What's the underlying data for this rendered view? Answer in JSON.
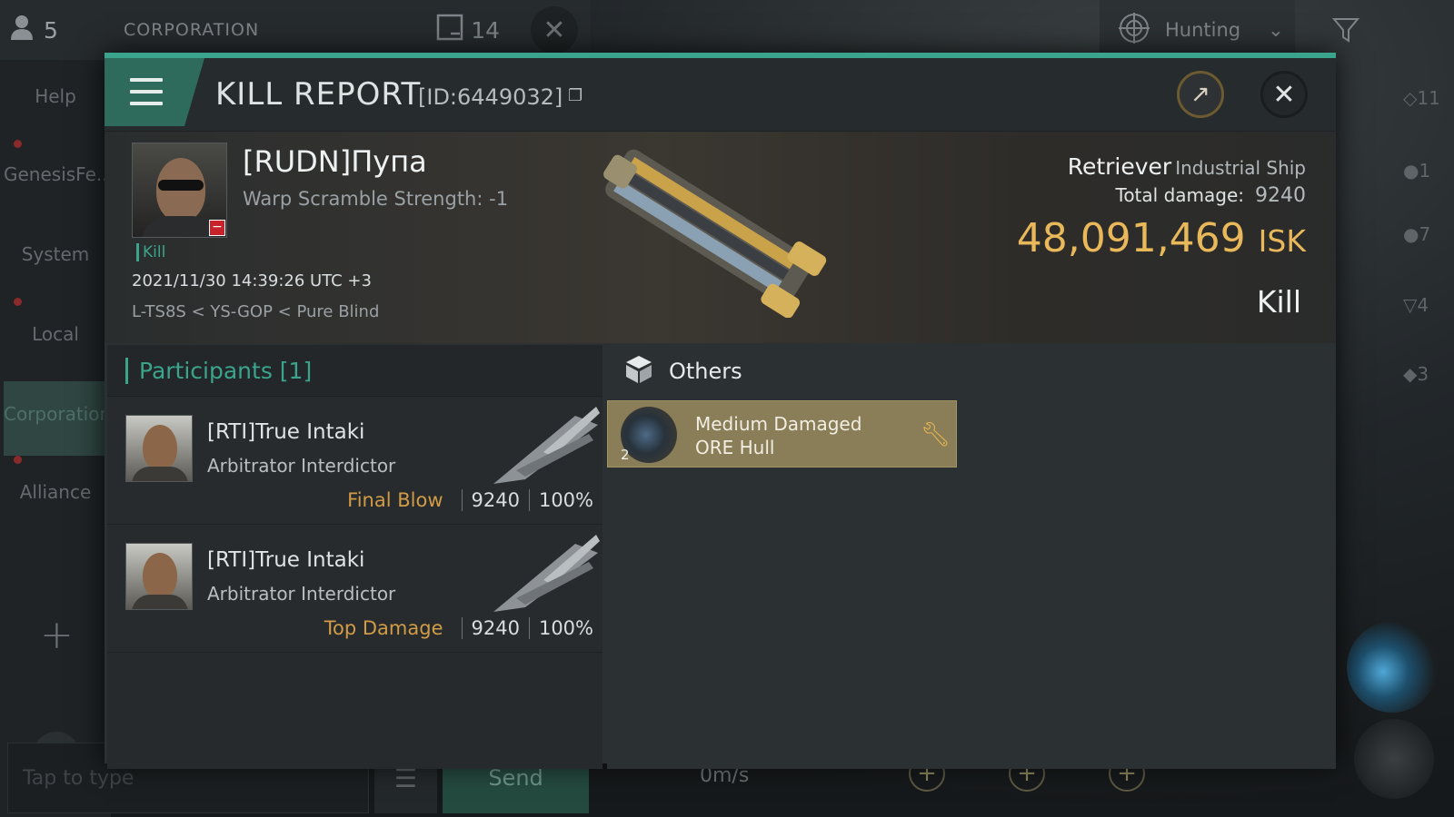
{
  "topbar": {
    "member_count": "5",
    "corp_label": "CORPORATION",
    "message_count": "14",
    "hunting_label": "Hunting"
  },
  "sidebar": {
    "items": [
      {
        "label": "Help"
      },
      {
        "label": "GenesisFe..."
      },
      {
        "label": "System"
      },
      {
        "label": "Local"
      },
      {
        "label": "Corporation"
      },
      {
        "label": "Alliance"
      }
    ]
  },
  "chat": {
    "placeholder": "Tap to type",
    "send_label": "Send"
  },
  "right_counts": [
    "11",
    "1",
    "7",
    "4",
    "3"
  ],
  "hud": {
    "speed": "0m/s"
  },
  "report": {
    "title": "KILL REPORT",
    "id_label": "[ID:6449032]",
    "victim": {
      "name": "[RUDN]Пупа",
      "warp": "Warp Scramble Strength: -1",
      "tag": "Kill",
      "time": "2021/11/30 14:39:26 UTC +3",
      "location": "L-TS8S < YS-GOP < Pure Blind"
    },
    "ship": {
      "name": "Retriever",
      "type": "Industrial Ship",
      "damage_label": "Total damage:",
      "damage": "9240",
      "isk": "48,091,469",
      "isk_unit": "ISK",
      "result": "Kill"
    },
    "participants": {
      "header": "Participants [1]",
      "rows": [
        {
          "name": "[RTI]True Intaki",
          "ship": "Arbitrator Interdictor",
          "tag": "Final Blow",
          "damage": "9240",
          "pct": "100%"
        },
        {
          "name": "[RTI]True Intaki",
          "ship": "Arbitrator Interdictor",
          "tag": "Top Damage",
          "damage": "9240",
          "pct": "100%"
        }
      ]
    },
    "others": {
      "header": "Others",
      "items": [
        {
          "qty": "2",
          "line1": "Medium Damaged",
          "line2": "ORE Hull"
        }
      ]
    }
  },
  "colors": {
    "accent": "#3aa58c",
    "isk": "#e8b85a",
    "tag": "#d29c46"
  }
}
